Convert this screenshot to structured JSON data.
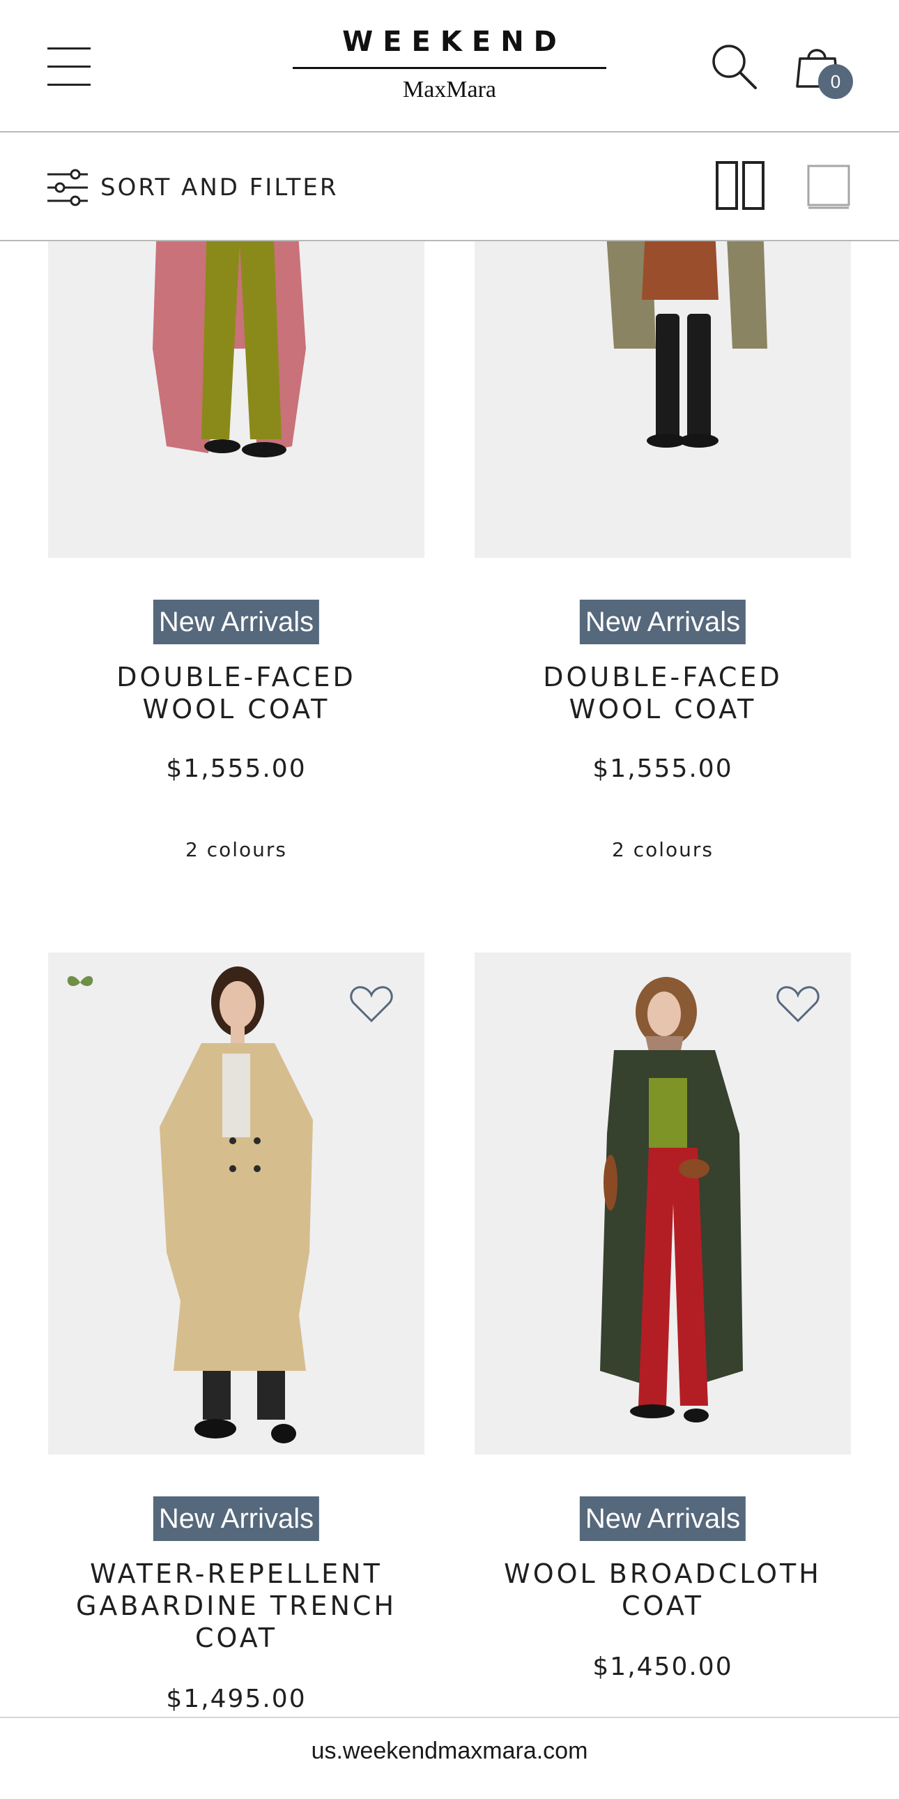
{
  "header": {
    "brand_top": "WEEKEND",
    "brand_bottom": "MaxMara",
    "cart_count": "0",
    "icons": [
      "menu-icon",
      "search-icon",
      "shopping-bag-icon"
    ]
  },
  "filterbar": {
    "label": "SORT AND FILTER",
    "icons": [
      "sliders-icon",
      "two-column-view-icon",
      "single-column-view-icon"
    ]
  },
  "products": [
    {
      "badge": "New Arrivals",
      "name_lines": [
        "DOUBLE-FACED",
        "WOOL COAT"
      ],
      "price": "$1,555.00",
      "colours": "2 colours"
    },
    {
      "badge": "New Arrivals",
      "name_lines": [
        "DOUBLE-FACED",
        "WOOL COAT"
      ],
      "price": "$1,555.00",
      "colours": "2 colours"
    },
    {
      "badge": "New Arrivals",
      "name_lines": [
        "WATER-REPELLENT",
        "GABARDINE TRENCH",
        "COAT"
      ],
      "price": "$1,495.00",
      "icons": [
        "wishlist-heart-icon",
        "butterfly-icon"
      ]
    },
    {
      "badge": "New Arrivals",
      "name_lines": [
        "WOOL BROADCLOTH",
        "COAT"
      ],
      "price": "$1,450.00",
      "icons": [
        "wishlist-heart-icon"
      ]
    }
  ],
  "colors": {
    "badge_bg": "#56687c",
    "badge_text": "#ffffff",
    "photo_bg": "#efeff0",
    "butterfly": "#6f8f47"
  },
  "url_bar": {
    "url": "us.weekendmaxmara.com"
  }
}
